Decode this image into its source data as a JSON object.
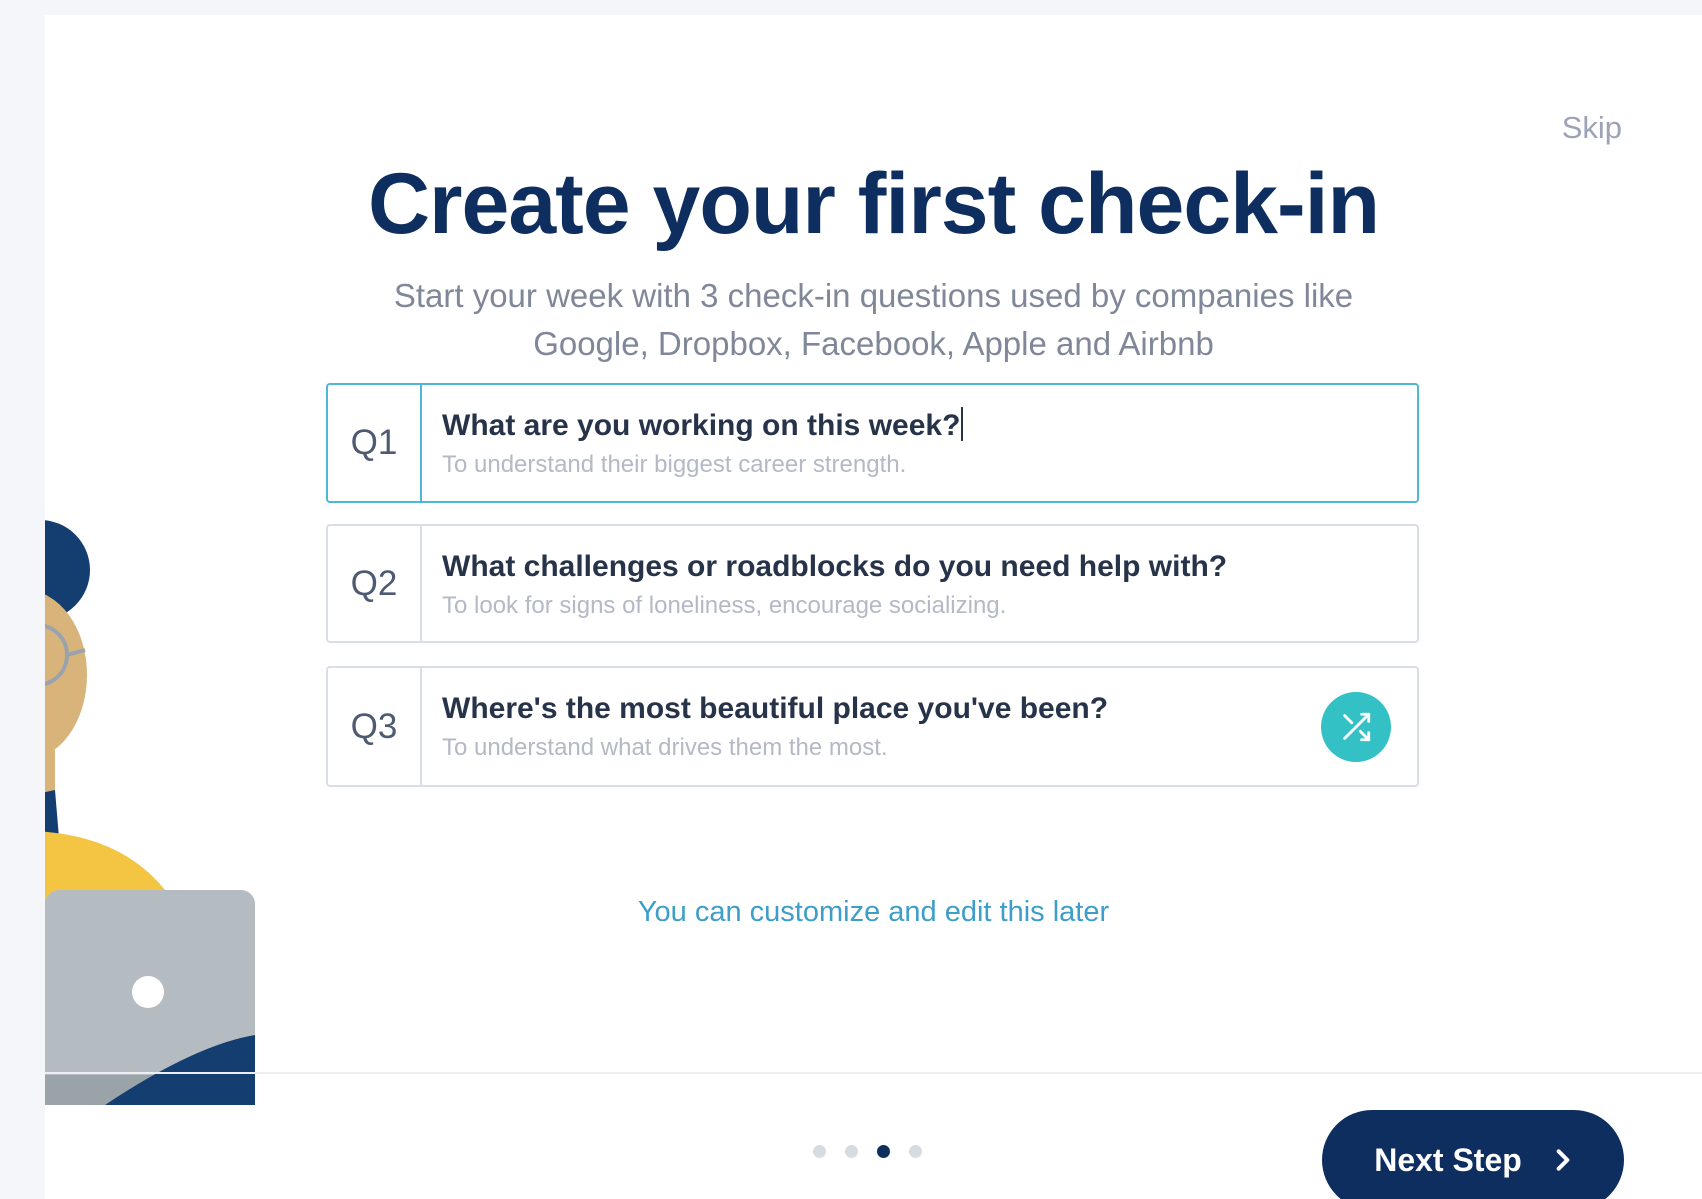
{
  "header": {
    "skip_label": "Skip"
  },
  "hero": {
    "title": "Create your first check-in",
    "subtitle_line1": "Start your week with 3 check-in questions used by companies like",
    "subtitle_line2": "Google, Dropbox, Facebook, Apple and Airbnb"
  },
  "questions": [
    {
      "number": "Q1",
      "title": "What are you working on this week?",
      "description": "To understand their biggest career strength."
    },
    {
      "number": "Q2",
      "title": "What challenges or roadblocks do you need help with?",
      "description": "To look for signs of loneliness, encourage socializing."
    },
    {
      "number": "Q3",
      "title": "Where's the most beautiful place you've been?",
      "description": "To understand what drives them the most."
    }
  ],
  "hint_text": "You can customize and edit this later",
  "pagination": {
    "total_steps": 4,
    "current_step": 3
  },
  "footer": {
    "next_label": "Next Step",
    "next_icon": "chevron-right-icon",
    "shuffle_icon": "shuffle-icon"
  },
  "colors": {
    "brand_navy": "#0e2e5f",
    "accent_teal": "#33c1c6",
    "active_border": "#4eb6d6",
    "hint_blue": "#3d9ec9"
  }
}
